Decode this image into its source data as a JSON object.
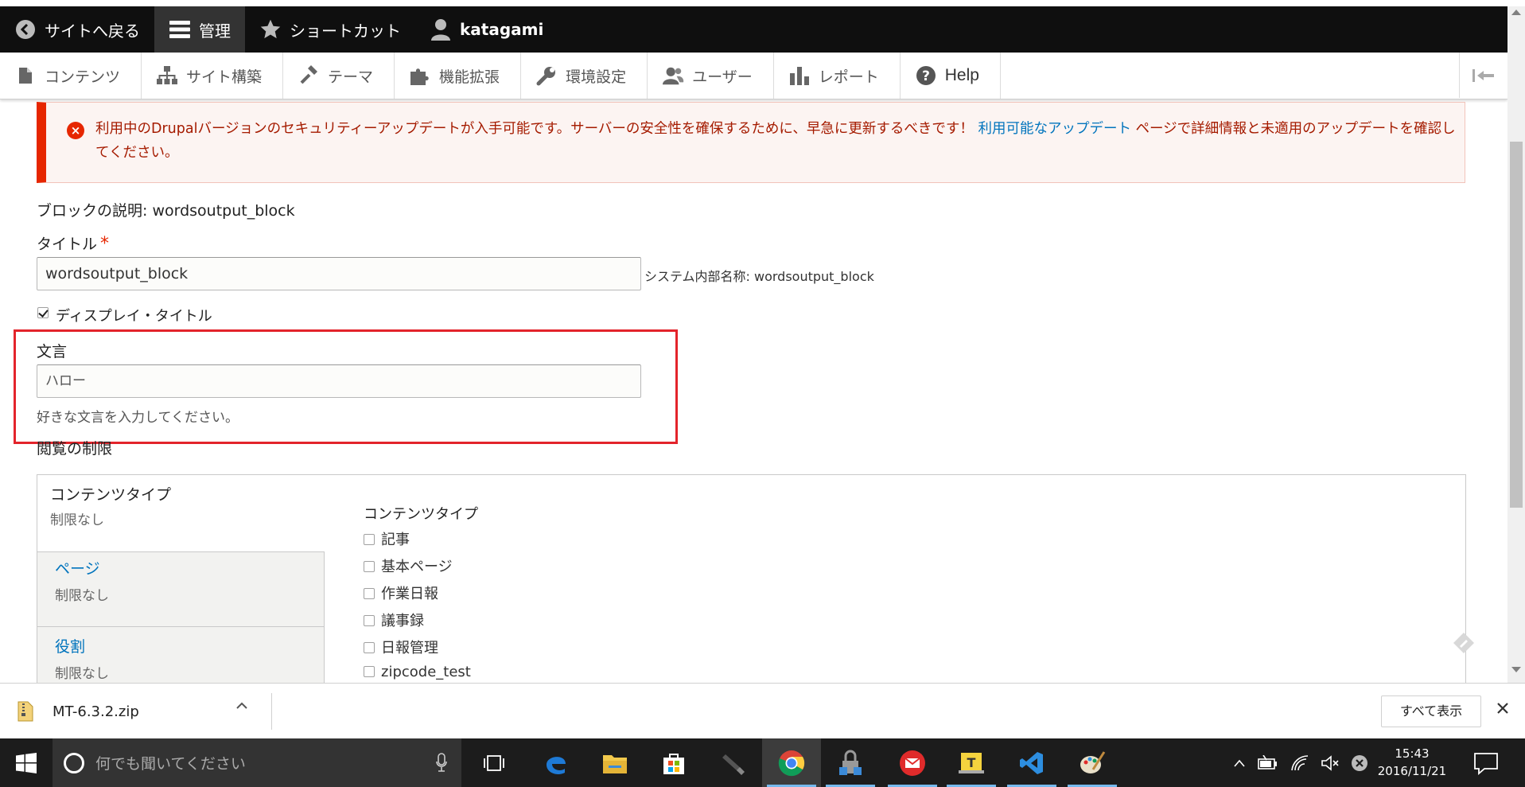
{
  "toolbar": {
    "back_to_site": "サイトへ戻る",
    "manage": "管理",
    "shortcuts": "ショートカット",
    "user": "katagami"
  },
  "tray": {
    "items": [
      {
        "label": "コンテンツ",
        "icon": "file-icon"
      },
      {
        "label": "サイト構築",
        "icon": "sitemap-icon"
      },
      {
        "label": "テーマ",
        "icon": "paintbrush-icon"
      },
      {
        "label": "機能拡張",
        "icon": "puzzle-icon"
      },
      {
        "label": "環境設定",
        "icon": "wrench-icon"
      },
      {
        "label": "ユーザー",
        "icon": "people-icon"
      },
      {
        "label": "レポート",
        "icon": "bar-chart-icon"
      },
      {
        "label": "Help",
        "icon": "help-icon"
      }
    ]
  },
  "error": {
    "text_before_link": "利用中のDrupalバージョンのセキュリティーアップデートが入手可能です。サーバーの安全性を確保するために、早急に更新するべきです！ ",
    "link": "利用可能なアップデート",
    "text_after_link": " ページで詳細情報と未適用のアップデートを確認してください。"
  },
  "form": {
    "block_description": "ブロックの説明: wordsoutput_block",
    "title_label": "タイトル",
    "required_mark": "*",
    "title_value": "wordsoutput_block",
    "machine_name": "システム内部名称: wordsoutput_block",
    "display_title_label": "ディスプレイ・タイトル",
    "display_title_checked": true,
    "words_label": "文言",
    "words_value": "ハロー",
    "words_help": "好きな文言を入力してください。",
    "visibility_label": "閲覧の制限"
  },
  "vertical_tabs": [
    {
      "title": "コンテンツタイプ",
      "summary": "制限なし"
    },
    {
      "title": "ページ",
      "summary": "制限なし"
    },
    {
      "title": "役割",
      "summary": "制限なし"
    }
  ],
  "content_types_pane": {
    "title": "コンテンツタイプ",
    "options": [
      "記事",
      "基本ページ",
      "作業日報",
      "議事録",
      "日報管理",
      "zipcode_test"
    ]
  },
  "downloads": {
    "file_name": "MT-6.3.2.zip",
    "show_all": "すべて表示"
  },
  "taskbar": {
    "search_placeholder": "何でも聞いてください",
    "time": "15:43",
    "date": "2016/11/21"
  },
  "colors": {
    "error_red": "#e62600",
    "link_blue": "#0074bd",
    "highlight_red": "#e3242b",
    "toolbar_black": "#0f0f0f"
  }
}
